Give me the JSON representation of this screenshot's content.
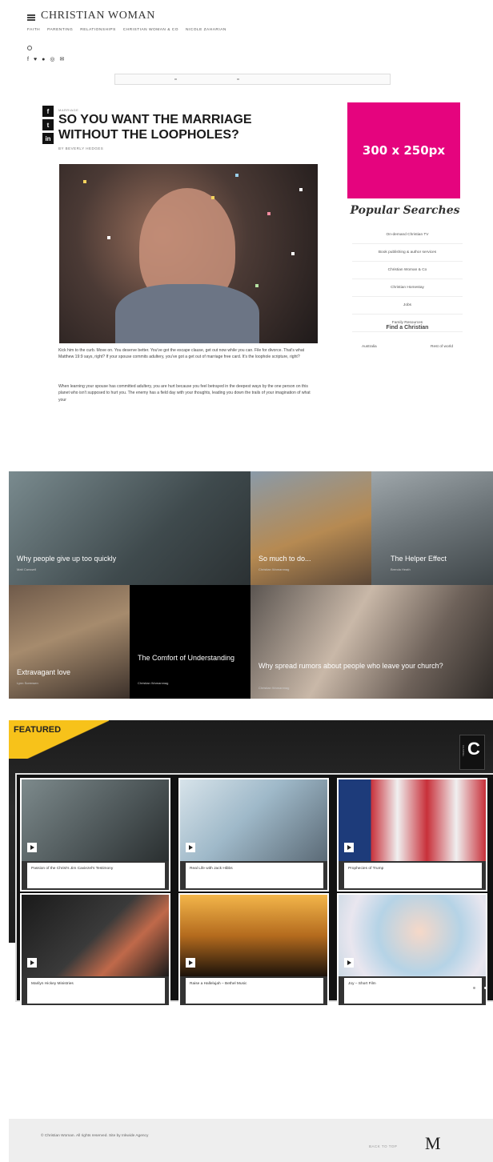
{
  "header": {
    "brand": "CHRISTIAN WOMAN",
    "nav": [
      "FAITH",
      "PARENTING",
      "RELATIONSHIPS",
      "CHRISTIAN WOMAN & CO",
      "NICOLE ZAHARIAN"
    ],
    "social_icons": [
      "facebook-icon",
      "twitter-icon",
      "pinterest-icon",
      "instagram-icon",
      "email-icon"
    ]
  },
  "share": {
    "facebook": "f",
    "twitter": "t",
    "linkedin": "in"
  },
  "article": {
    "category": "MARRIAGE",
    "title": "SO YOU WANT THE MARRIAGE WITHOUT THE LOOPHOLES?",
    "byline": "BY BEVERLY HEDGES",
    "para1": "Kick him to the curb. Move on. You deserve better. You've got the escape clause, get out now while you can. File for divorce. That's what Matthew 19:9 says, right? If your spouse commits adultery, you've got a get out of marriage free card. It's the loophole scripture, right?",
    "para2": "When learning your spouse has committed adultery, you are hurt because you feel betrayed in the deepest ways by the one person on this planet who isn't supposed to hurt you. The enemy has a field day with your thoughts, leading you down the trails of your imagination of what your"
  },
  "sidebar": {
    "ad_label": "300 x 250px",
    "popular_title": "Popular Searches",
    "popular_items": [
      "On-demand Christian TV",
      "Book publishing & author services",
      "Christian Woman & Co",
      "Christian Homestay",
      "Jobs",
      "Family Resources"
    ],
    "find_title": "Find a Christian",
    "find_links": [
      "Australia",
      "Rest of world"
    ]
  },
  "grid": {
    "tiles": [
      {
        "title": "Why people give up too quickly",
        "author": "Matt Carswell"
      },
      {
        "title": "So much to do...",
        "author": "Christian Womanmag"
      },
      {
        "title": "The Helper Effect",
        "author": "Brenda Heath"
      },
      {
        "title": "Extravagant love",
        "author": "Lynn Sorensen"
      },
      {
        "title": "The Comfort of Understanding",
        "author": "Christian Womanmag"
      },
      {
        "title": "Why spread rumors about people who leave your church?",
        "author": "Christian Womanmag"
      }
    ]
  },
  "featured": {
    "label": "FEATURED",
    "channel_letter": "C",
    "channel_word": "CHANNEL",
    "videos": [
      {
        "title": "Passion of the Christ's Jim Caviezel's Testimony"
      },
      {
        "title": "Real Life with Jack Hibbs"
      },
      {
        "title": "Prophecies of Trump"
      },
      {
        "title": "Marilyn Hickey Ministries"
      },
      {
        "title": "Raise a Hallelujah – Bethel Music"
      },
      {
        "title": "Joy – Short Film"
      }
    ]
  },
  "footer": {
    "copyright": "© Christian Woman. All rights reserved. Site by Inkwide Agency",
    "back_to_top": "BACK TO TOP",
    "logo": "M"
  },
  "colors": {
    "ad_pink": "#e5047e",
    "featured_yellow": "#f7c21a"
  }
}
